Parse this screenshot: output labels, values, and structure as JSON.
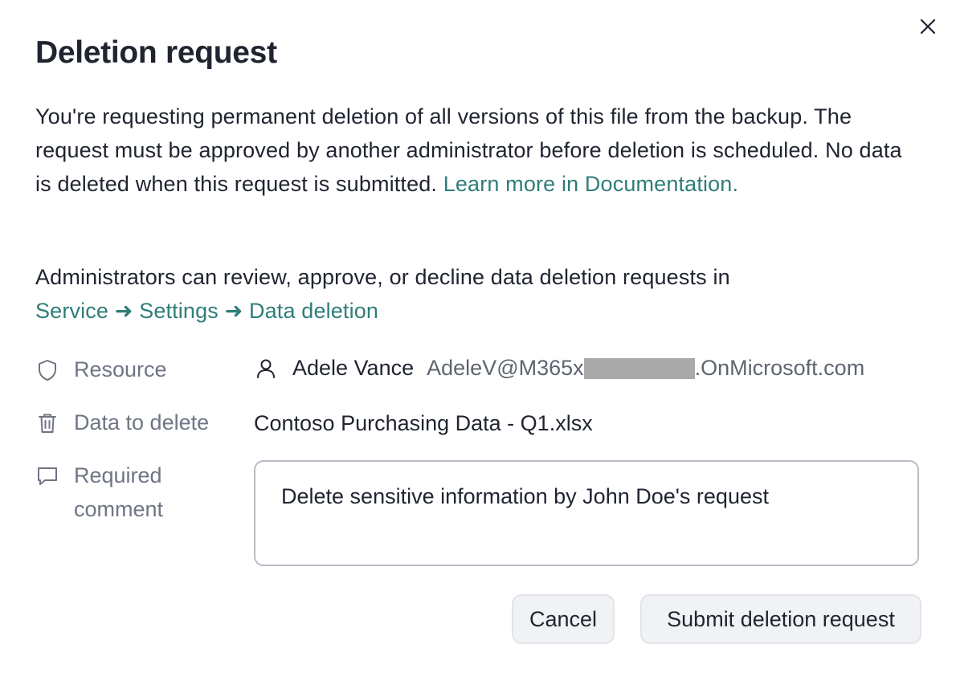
{
  "dialog": {
    "title": "Deletion request",
    "close_icon": "close-icon"
  },
  "intro": {
    "text": "You're requesting permanent deletion of all versions of this file from the backup. The request must be approved by another administrator before deletion is scheduled. No data is deleted when this request is submitted. ",
    "link": "Learn more in Documentation."
  },
  "admin_note": {
    "text": "Administrators can review, approve, or decline data deletion requests in",
    "path_link": "Service ➜ Settings ➜ Data deletion"
  },
  "fields": {
    "resource": {
      "label": "Resource",
      "icon": "shield-icon",
      "user_icon": "person-icon",
      "user_name": "Adele Vance",
      "email_prefix": "AdeleV@M365x",
      "email_suffix": ".OnMicrosoft.com"
    },
    "data_to_delete": {
      "label": "Data to delete",
      "icon": "trash-icon",
      "value": "Contoso Purchasing Data - Q1.xlsx"
    },
    "comment": {
      "label": "Required comment",
      "icon": "comment-icon",
      "value": "Delete sensitive information by John Doe's request"
    }
  },
  "actions": {
    "cancel_label": "Cancel",
    "submit_label": "Submit deletion request"
  },
  "colors": {
    "link": "#2f7d78",
    "text": "#1f2430",
    "muted": "#6e7583",
    "button_bg": "#f1f2f5"
  }
}
